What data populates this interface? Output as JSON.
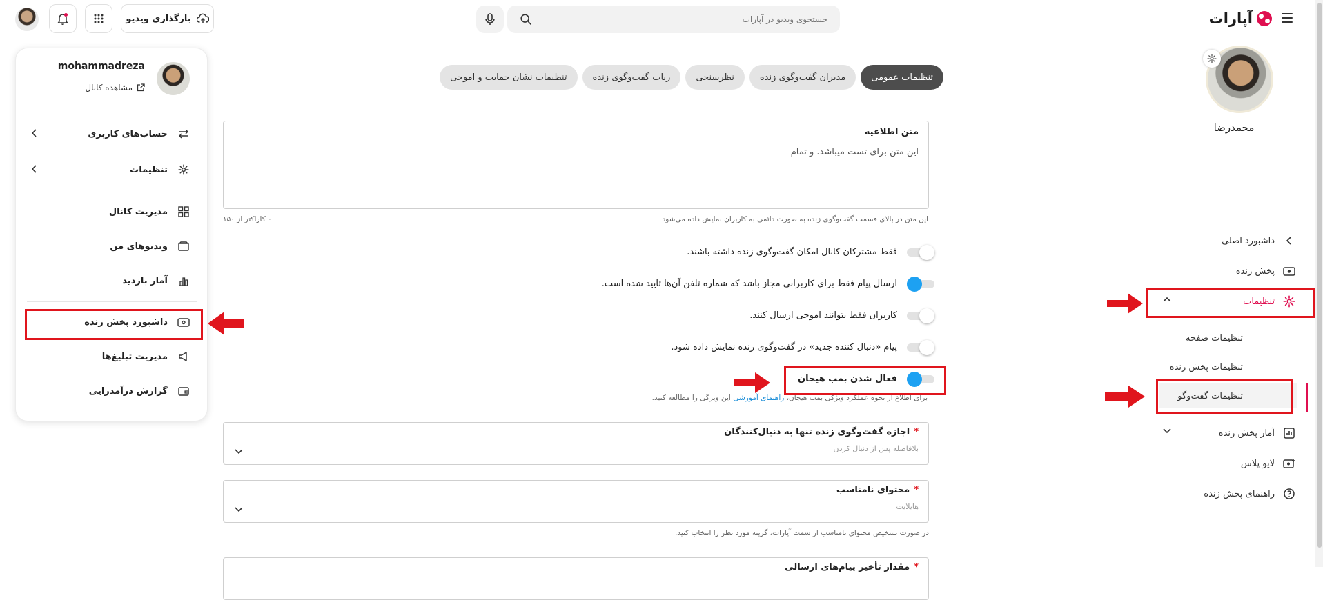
{
  "header": {
    "logo_text": "آپارات",
    "search_placeholder": "جستجوی ویدیو در آپارات",
    "upload_label": "بارگذاری ویدیو"
  },
  "sidebar": {
    "profile_name": "محمدرضا",
    "items": [
      {
        "label": "داشبورد اصلی",
        "icon": "chevron-left-icon"
      },
      {
        "label": "پخش زنده",
        "icon": "live-icon"
      },
      {
        "label": "تنظیمات",
        "icon": "gear-icon",
        "active": true
      },
      {
        "label": "آمار پخش زنده",
        "icon": "chart-icon"
      },
      {
        "label": "لایو پلاس",
        "icon": "live-plus-icon"
      },
      {
        "label": "راهنمای پخش زنده",
        "icon": "help-icon"
      }
    ],
    "subitems": [
      {
        "label": "تنظیمات صفحه"
      },
      {
        "label": "تنظیمات پخش زنده"
      },
      {
        "label": "تنظیمات گفت‌وگو",
        "selected": true
      }
    ]
  },
  "tabs": [
    {
      "label": "تنظیمات عمومی",
      "active": true
    },
    {
      "label": "مدیران گفت‌وگوی زنده"
    },
    {
      "label": "نظرسنجی"
    },
    {
      "label": "ربات گفت‌وگوی زنده"
    },
    {
      "label": "تنظیمات نشان حمایت و اموجی"
    }
  ],
  "notice": {
    "label": "متن اطلاعیه",
    "value": "این متن برای تست میباشد. و تمام",
    "help": "این متن در بالای قسمت گفت‌وگوی زنده به صورت دائمی به کاربران نمایش داده می‌شود",
    "counter": "۰ کاراکتر از ۱۵۰"
  },
  "toggles": [
    {
      "label": "فقط مشترکان کانال امکان گفت‌وگوی زنده داشته باشند.",
      "state": "off"
    },
    {
      "label": "ارسال پیام فقط برای کاربرانی مجاز باشد که شماره تلفن آن‌ها تایید شده است.",
      "state": "on"
    },
    {
      "label": "کاربران فقط بتوانند اموجی ارسال کنند.",
      "state": "off"
    },
    {
      "label": "پیام «دنبال کننده جدید» در گفت‌وگوی زنده نمایش داده شود.",
      "state": "off"
    },
    {
      "label": "فعال شدن بمب هیجان",
      "state": "on"
    }
  ],
  "bomb_hint": {
    "before": "برای اطلاع از نحوه عملکرد ویژگی بمب هیجان،",
    "link": "راهنمای آموزشی",
    "after": "این ویژگی را مطالعه کنید."
  },
  "selects": [
    {
      "label": "اجازه گفت‌وگوی زنده تنها به دنبال‌کنندگان",
      "value": "بلافاصله پس از دنبال کردن",
      "required": "*"
    },
    {
      "label": "محتوای نامناسب",
      "value": "هایلایت",
      "required": "*"
    },
    {
      "label": "مقدار تأخیر پیام‌های ارسالی",
      "value": "",
      "required": "*"
    }
  ],
  "inappropriate_help": "در صورت تشخیص محتوای نامناسب از سمت آپارات، گزینه مورد نظر را انتخاب کنید.",
  "account_menu": {
    "username": "mohammadreza",
    "view_channel": "مشاهده کانال",
    "items": [
      {
        "label": "حساب‌های کاربری",
        "icon": "switch-account-icon",
        "chevron": true
      },
      {
        "label": "تنظیمات",
        "icon": "gear-icon",
        "chevron": true
      },
      {
        "label": "مدیریت کانال",
        "icon": "grid-icon"
      },
      {
        "label": "ویدیوهای من",
        "icon": "video-folder-icon"
      },
      {
        "label": "آمار بازدید",
        "icon": "stats-icon"
      },
      {
        "label": "داشبورد پخش زنده",
        "icon": "live-dashboard-icon"
      },
      {
        "label": "مدیریت تبلیغ‌ها",
        "icon": "ads-icon"
      },
      {
        "label": "گزارش درآمدزایی",
        "icon": "wallet-icon"
      }
    ]
  },
  "colors": {
    "accent": "#df0f50",
    "toggle_on": "#1da1f2",
    "annotation_red": "#e0151d",
    "tab_active": "#4d4d4d"
  }
}
